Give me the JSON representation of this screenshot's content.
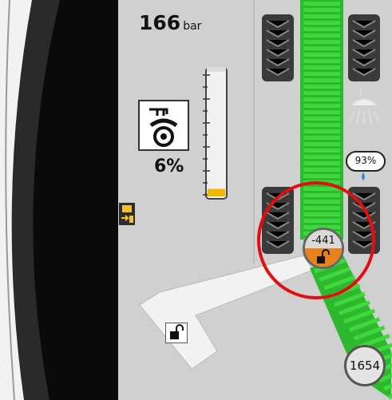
{
  "header": {
    "pressure_value": "166",
    "pressure_unit": "bar"
  },
  "tank": {
    "level_percent_label": "6%",
    "level_fraction": 0.06,
    "tool_icon": "tractor-weight-icon"
  },
  "status": {
    "humidity_label": "93%",
    "spray_icon": "shower-icon"
  },
  "unloader": {
    "top_counter": "-441",
    "bottom_counter": "1654",
    "top_lock_icon": "unlock-icon",
    "boom_lock_icon": "unlock-icon"
  },
  "colors": {
    "belt_green": "#3fd93f",
    "fill_yellow": "#f0b800",
    "highlight_red": "#e01010",
    "lock_orange": "#e8831a",
    "background": "#d0d0d0"
  }
}
